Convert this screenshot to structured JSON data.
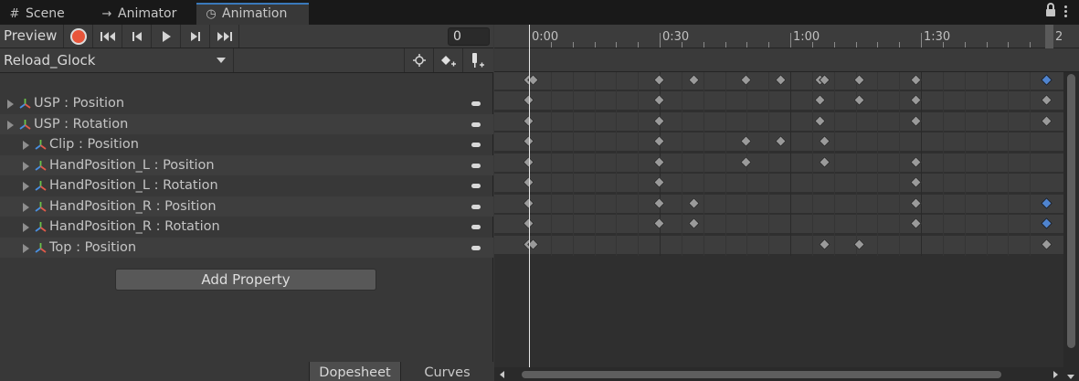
{
  "tabs": [
    {
      "label": "Scene",
      "icon": "grid-icon"
    },
    {
      "label": "Animator",
      "icon": "animator-icon"
    },
    {
      "label": "Animation",
      "icon": "clock-icon",
      "active": true
    }
  ],
  "toolbar": {
    "preview_label": "Preview",
    "frame_value": "0"
  },
  "clip": {
    "name": "Reload_Glock"
  },
  "properties": [
    {
      "name": "USP : Position"
    },
    {
      "name": "USP : Rotation"
    },
    {
      "name": "Clip : Position"
    },
    {
      "name": "HandPosition_L : Position"
    },
    {
      "name": "HandPosition_L : Rotation"
    },
    {
      "name": "HandPosition_R : Position"
    },
    {
      "name": "HandPosition_R : Rotation"
    },
    {
      "name": "Top : Position"
    }
  ],
  "add_property_label": "Add Property",
  "view_tabs": {
    "dopesheet": "Dopesheet",
    "curves": "Curves"
  },
  "timeline": {
    "ruler_labels": [
      "0:00",
      "0:30",
      "1:00",
      "1:30"
    ],
    "end_label": "2",
    "keyframe_times": {
      "summary": [
        "0:00",
        "0:01",
        "0:30",
        "0:38",
        "0:50",
        "0:58",
        "1:07",
        "1:08",
        "1:16",
        "1:29",
        "1:59"
      ],
      "USP : Position": [
        "0:00",
        "0:30",
        "1:07",
        "1:16",
        "1:29",
        "1:59"
      ],
      "USP : Rotation": [
        "0:00",
        "0:30",
        "1:07",
        "1:29",
        "1:59"
      ],
      "Clip : Position": [
        "0:00",
        "0:30",
        "0:50",
        "0:58",
        "1:08"
      ],
      "HandPosition_L : Position": [
        "0:00",
        "0:30",
        "0:50",
        "1:08",
        "1:29"
      ],
      "HandPosition_L : Rotation": [
        "0:00",
        "0:30",
        "1:29"
      ],
      "HandPosition_R : Position": [
        "0:00",
        "0:30",
        "0:38",
        "1:29",
        "1:59"
      ],
      "HandPosition_R : Rotation": [
        "0:00",
        "0:30",
        "0:38",
        "1:29",
        "1:59"
      ],
      "Top : Position": [
        "0:00",
        "0:01",
        "1:08",
        "1:16",
        "1:59"
      ]
    }
  },
  "colors": {
    "accent": "#3a79bb",
    "record": "#e8553a",
    "keyframe": "#9a9a9a",
    "keyframe_selected": "#4f84d0"
  }
}
